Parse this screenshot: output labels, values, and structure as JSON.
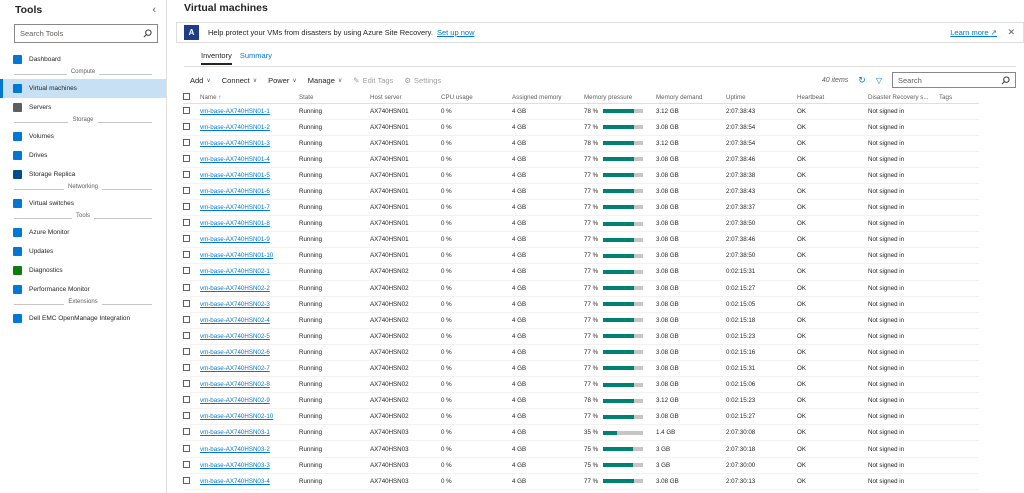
{
  "sidebar": {
    "title": "Tools",
    "search_placeholder": "Search Tools",
    "items": [
      {
        "type": "item",
        "label": "Dashboard",
        "icon": "home-icon",
        "color": "#0078d4"
      },
      {
        "type": "section",
        "label": "Compute"
      },
      {
        "type": "item",
        "label": "Virtual machines",
        "icon": "vm-icon",
        "color": "#0078d4",
        "active": true
      },
      {
        "type": "item",
        "label": "Servers",
        "icon": "server-icon",
        "color": "#605e5c"
      },
      {
        "type": "section",
        "label": "Storage"
      },
      {
        "type": "item",
        "label": "Volumes",
        "icon": "volume-icon",
        "color": "#0078d4"
      },
      {
        "type": "item",
        "label": "Drives",
        "icon": "drive-icon",
        "color": "#0078d4"
      },
      {
        "type": "item",
        "label": "Storage Replica",
        "icon": "storage-replica-icon",
        "color": "#004e8c"
      },
      {
        "type": "section",
        "label": "Networking"
      },
      {
        "type": "item",
        "label": "Virtual switches",
        "icon": "switch-icon",
        "color": "#0078d4"
      },
      {
        "type": "section",
        "label": "Tools"
      },
      {
        "type": "item",
        "label": "Azure Monitor",
        "icon": "monitor-icon",
        "color": "#0078d4"
      },
      {
        "type": "item",
        "label": "Updates",
        "icon": "updates-icon",
        "color": "#0078d4"
      },
      {
        "type": "item",
        "label": "Diagnostics",
        "icon": "diagnostics-icon",
        "color": "#107c10"
      },
      {
        "type": "item",
        "label": "Performance Monitor",
        "icon": "performance-icon",
        "color": "#0078d4"
      },
      {
        "type": "section",
        "label": "Extensions"
      },
      {
        "type": "item",
        "label": "Dell EMC OpenManage Integration",
        "icon": "dell-icon",
        "color": "#0078d4"
      }
    ]
  },
  "main": {
    "title": "Virtual machines",
    "banner": {
      "message": "Help protect your VMs from disasters by using Azure Site Recovery.",
      "link": "Set up now",
      "learn_more": "Learn more"
    },
    "tabs": [
      {
        "label": "Inventory",
        "active": true
      },
      {
        "label": "Summary",
        "active": false
      }
    ],
    "toolbar": {
      "add": "Add",
      "connect": "Connect",
      "power": "Power",
      "manage": "Manage",
      "edit_tags": "Edit Tags",
      "settings": "Settings",
      "count": "40 items",
      "search_placeholder": "Search"
    },
    "columns": [
      "Name ↑",
      "State",
      "Host server",
      "CPU usage",
      "Assigned memory",
      "Memory pressure",
      "Memory demand",
      "Uptime",
      "Heartbeat",
      "Disaster Recovery s...",
      "Tags"
    ],
    "rows": [
      {
        "name": "vm-base-AX740HSN01-1",
        "state": "Running",
        "host": "AX740HSN01",
        "cpu": "0 %",
        "mem": "4 GB",
        "pressure": "78 %",
        "pressure_pct": 78,
        "demand": "3.12 GB",
        "uptime": "2:07:38:43",
        "heartbeat": "OK",
        "dr": "Not signed in"
      },
      {
        "name": "vm-base-AX740HSN01-2",
        "state": "Running",
        "host": "AX740HSN01",
        "cpu": "0 %",
        "mem": "4 GB",
        "pressure": "77 %",
        "pressure_pct": 77,
        "demand": "3.08 GB",
        "uptime": "2:07:38:54",
        "heartbeat": "OK",
        "dr": "Not signed in"
      },
      {
        "name": "vm-base-AX740HSN01-3",
        "state": "Running",
        "host": "AX740HSN01",
        "cpu": "0 %",
        "mem": "4 GB",
        "pressure": "78 %",
        "pressure_pct": 78,
        "demand": "3.12 GB",
        "uptime": "2:07:38:54",
        "heartbeat": "OK",
        "dr": "Not signed in"
      },
      {
        "name": "vm-base-AX740HSN01-4",
        "state": "Running",
        "host": "AX740HSN01",
        "cpu": "0 %",
        "mem": "4 GB",
        "pressure": "77 %",
        "pressure_pct": 77,
        "demand": "3.08 GB",
        "uptime": "2:07:38:46",
        "heartbeat": "OK",
        "dr": "Not signed in"
      },
      {
        "name": "vm-base-AX740HSN01-5",
        "state": "Running",
        "host": "AX740HSN01",
        "cpu": "0 %",
        "mem": "4 GB",
        "pressure": "77 %",
        "pressure_pct": 77,
        "demand": "3.08 GB",
        "uptime": "2:07:38:38",
        "heartbeat": "OK",
        "dr": "Not signed in"
      },
      {
        "name": "vm-base-AX740HSN01-6",
        "state": "Running",
        "host": "AX740HSN01",
        "cpu": "0 %",
        "mem": "4 GB",
        "pressure": "77 %",
        "pressure_pct": 77,
        "demand": "3.08 GB",
        "uptime": "2:07:38:43",
        "heartbeat": "OK",
        "dr": "Not signed in"
      },
      {
        "name": "vm-base-AX740HSN01-7",
        "state": "Running",
        "host": "AX740HSN01",
        "cpu": "0 %",
        "mem": "4 GB",
        "pressure": "77 %",
        "pressure_pct": 77,
        "demand": "3.08 GB",
        "uptime": "2:07:38:37",
        "heartbeat": "OK",
        "dr": "Not signed in"
      },
      {
        "name": "vm-base-AX740HSN01-8",
        "state": "Running",
        "host": "AX740HSN01",
        "cpu": "0 %",
        "mem": "4 GB",
        "pressure": "77 %",
        "pressure_pct": 77,
        "demand": "3.08 GB",
        "uptime": "2:07:38:50",
        "heartbeat": "OK",
        "dr": "Not signed in"
      },
      {
        "name": "vm-base-AX740HSN01-9",
        "state": "Running",
        "host": "AX740HSN01",
        "cpu": "0 %",
        "mem": "4 GB",
        "pressure": "77 %",
        "pressure_pct": 77,
        "demand": "3.08 GB",
        "uptime": "2:07:38:46",
        "heartbeat": "OK",
        "dr": "Not signed in"
      },
      {
        "name": "vm-base-AX740HSN01-10",
        "state": "Running",
        "host": "AX740HSN01",
        "cpu": "0 %",
        "mem": "4 GB",
        "pressure": "77 %",
        "pressure_pct": 77,
        "demand": "3.08 GB",
        "uptime": "2:07:38:50",
        "heartbeat": "OK",
        "dr": "Not signed in"
      },
      {
        "name": "vm-base-AX740HSN02-1",
        "state": "Running",
        "host": "AX740HSN02",
        "cpu": "0 %",
        "mem": "4 GB",
        "pressure": "77 %",
        "pressure_pct": 77,
        "demand": "3.08 GB",
        "uptime": "0:02:15:31",
        "heartbeat": "OK",
        "dr": "Not signed in"
      },
      {
        "name": "vm-base-AX740HSN02-2",
        "state": "Running",
        "host": "AX740HSN02",
        "cpu": "0 %",
        "mem": "4 GB",
        "pressure": "77 %",
        "pressure_pct": 77,
        "demand": "3.08 GB",
        "uptime": "0:02:15:27",
        "heartbeat": "OK",
        "dr": "Not signed in"
      },
      {
        "name": "vm-base-AX740HSN02-3",
        "state": "Running",
        "host": "AX740HSN02",
        "cpu": "0 %",
        "mem": "4 GB",
        "pressure": "77 %",
        "pressure_pct": 77,
        "demand": "3.08 GB",
        "uptime": "0:02:15:05",
        "heartbeat": "OK",
        "dr": "Not signed in"
      },
      {
        "name": "vm-base-AX740HSN02-4",
        "state": "Running",
        "host": "AX740HSN02",
        "cpu": "0 %",
        "mem": "4 GB",
        "pressure": "77 %",
        "pressure_pct": 77,
        "demand": "3.08 GB",
        "uptime": "0:02:15:18",
        "heartbeat": "OK",
        "dr": "Not signed in"
      },
      {
        "name": "vm-base-AX740HSN02-5",
        "state": "Running",
        "host": "AX740HSN02",
        "cpu": "0 %",
        "mem": "4 GB",
        "pressure": "77 %",
        "pressure_pct": 77,
        "demand": "3.08 GB",
        "uptime": "0:02:15:23",
        "heartbeat": "OK",
        "dr": "Not signed in"
      },
      {
        "name": "vm-base-AX740HSN02-6",
        "state": "Running",
        "host": "AX740HSN02",
        "cpu": "0 %",
        "mem": "4 GB",
        "pressure": "77 %",
        "pressure_pct": 77,
        "demand": "3.08 GB",
        "uptime": "0:02:15:16",
        "heartbeat": "OK",
        "dr": "Not signed in"
      },
      {
        "name": "vm-base-AX740HSN02-7",
        "state": "Running",
        "host": "AX740HSN02",
        "cpu": "0 %",
        "mem": "4 GB",
        "pressure": "77 %",
        "pressure_pct": 77,
        "demand": "3.08 GB",
        "uptime": "0:02:15:31",
        "heartbeat": "OK",
        "dr": "Not signed in"
      },
      {
        "name": "vm-base-AX740HSN02-8",
        "state": "Running",
        "host": "AX740HSN02",
        "cpu": "0 %",
        "mem": "4 GB",
        "pressure": "77 %",
        "pressure_pct": 77,
        "demand": "3.08 GB",
        "uptime": "0:02:15:06",
        "heartbeat": "OK",
        "dr": "Not signed in"
      },
      {
        "name": "vm-base-AX740HSN02-9",
        "state": "Running",
        "host": "AX740HSN02",
        "cpu": "0 %",
        "mem": "4 GB",
        "pressure": "78 %",
        "pressure_pct": 78,
        "demand": "3.12 GB",
        "uptime": "0:02:15:23",
        "heartbeat": "OK",
        "dr": "Not signed in"
      },
      {
        "name": "vm-base-AX740HSN02-10",
        "state": "Running",
        "host": "AX740HSN02",
        "cpu": "0 %",
        "mem": "4 GB",
        "pressure": "77 %",
        "pressure_pct": 77,
        "demand": "3.08 GB",
        "uptime": "0:02:15:27",
        "heartbeat": "OK",
        "dr": "Not signed in"
      },
      {
        "name": "vm-base-AX740HSN03-1",
        "state": "Running",
        "host": "AX740HSN03",
        "cpu": "0 %",
        "mem": "4 GB",
        "pressure": "35 %",
        "pressure_pct": 35,
        "demand": "1.4 GB",
        "uptime": "2:07:30:08",
        "heartbeat": "OK",
        "dr": "Not signed in"
      },
      {
        "name": "vm-base-AX740HSN03-2",
        "state": "Running",
        "host": "AX740HSN03",
        "cpu": "0 %",
        "mem": "4 GB",
        "pressure": "75 %",
        "pressure_pct": 75,
        "demand": "3 GB",
        "uptime": "2:07:30:18",
        "heartbeat": "OK",
        "dr": "Not signed in"
      },
      {
        "name": "vm-base-AX740HSN03-3",
        "state": "Running",
        "host": "AX740HSN03",
        "cpu": "0 %",
        "mem": "4 GB",
        "pressure": "75 %",
        "pressure_pct": 75,
        "demand": "3 GB",
        "uptime": "2:07:30:00",
        "heartbeat": "OK",
        "dr": "Not signed in"
      },
      {
        "name": "vm-base-AX740HSN03-4",
        "state": "Running",
        "host": "AX740HSN03",
        "cpu": "0 %",
        "mem": "4 GB",
        "pressure": "77 %",
        "pressure_pct": 77,
        "demand": "3.08 GB",
        "uptime": "2:07:30:13",
        "heartbeat": "OK",
        "dr": "Not signed in"
      }
    ]
  }
}
